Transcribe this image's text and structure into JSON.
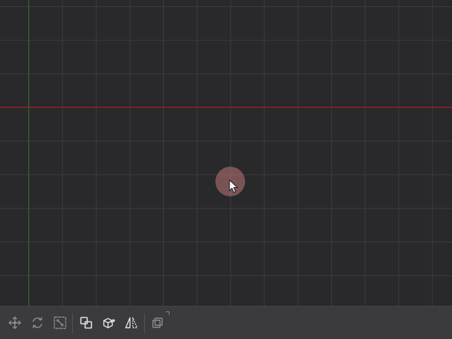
{
  "viewport": {
    "name": "3D viewport",
    "grid": true,
    "axis_x_color": "#7a2229",
    "axis_y_color": "#2f6b2f",
    "background_color": "#29292b"
  },
  "toolbar": {
    "tools": [
      {
        "icon": "move-icon",
        "state": "inactive"
      },
      {
        "icon": "rotate-icon",
        "state": "inactive"
      },
      {
        "icon": "scale-icon",
        "state": "inactive"
      },
      {
        "icon": "duplicate-icon",
        "state": "active"
      },
      {
        "icon": "extrude-icon",
        "state": "active"
      },
      {
        "icon": "mirror-icon",
        "state": "active"
      },
      {
        "icon": "copy-layers-icon",
        "state": "inactive"
      }
    ]
  }
}
